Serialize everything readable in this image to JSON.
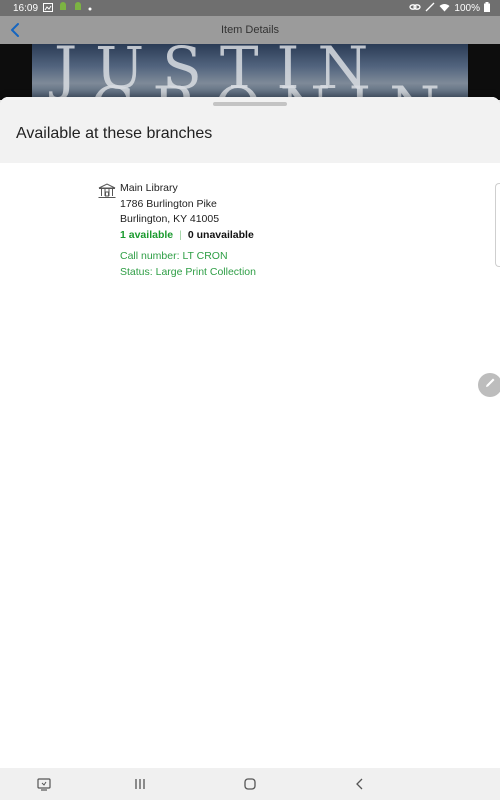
{
  "status_bar": {
    "time": "16:09",
    "battery": "100%",
    "icons": [
      "screenshot-icon",
      "android-icon",
      "android-icon",
      "dot-icon",
      "link-icon",
      "signal-off-icon",
      "wifi-icon",
      "battery-icon"
    ]
  },
  "app_bar": {
    "title": "Item Details",
    "back_icon": "chevron-left-icon"
  },
  "cover": {
    "text_line1": "JUSTIN",
    "text_line2": "CRONIN"
  },
  "sheet": {
    "title": "Available at these branches",
    "branches": [
      {
        "name": "Main Library",
        "address1": "1786 Burlington Pike",
        "address2": "Burlington, KY 41005",
        "available": "1 available",
        "separator": "|",
        "unavailable": "0 unavailable",
        "call_number": "Call number: LT CRON",
        "status": "Status: Large Print Collection",
        "icon": "bank-icon"
      }
    ]
  },
  "nav_bar": {
    "buttons": [
      "recent-screenshot-icon",
      "recents-icon",
      "home-icon",
      "back-icon"
    ]
  },
  "colors": {
    "status_bar": "#6f6f6f",
    "app_bar": "#9b9b9b",
    "available_green": "#1a9a2e",
    "text_green": "#2e9e45",
    "accent_blue": "#1565c0"
  }
}
